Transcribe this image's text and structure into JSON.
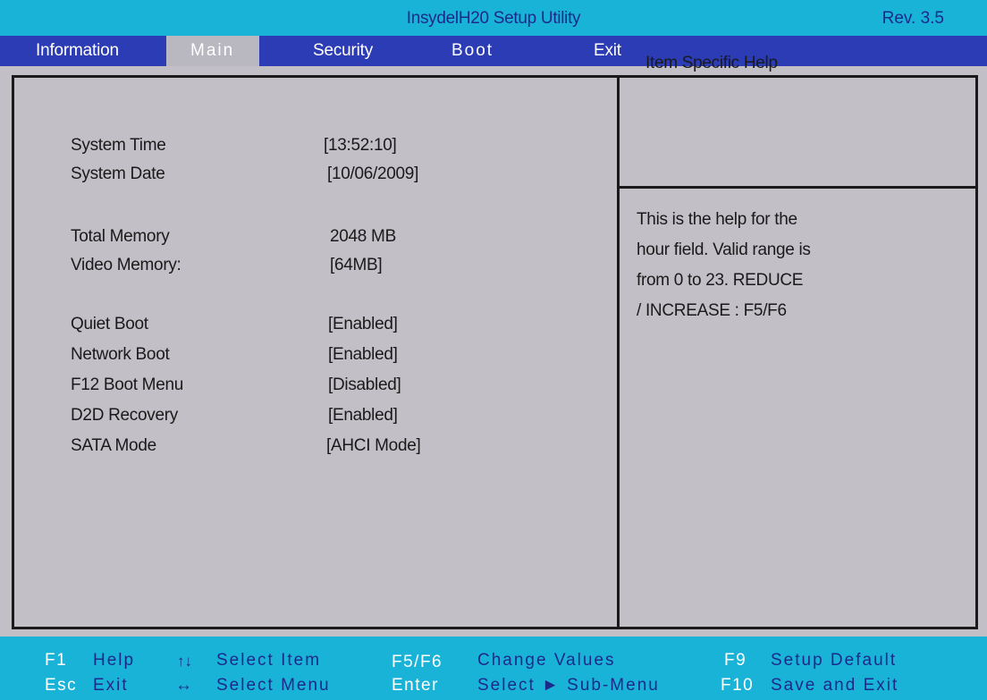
{
  "title_bar": {
    "title": "InsydelH20 Setup Utility",
    "revision": "Rev. 3.5"
  },
  "menu": {
    "items": [
      {
        "label": "Information"
      },
      {
        "label": "Main",
        "active": true
      },
      {
        "label": "Security"
      },
      {
        "label": "Boot"
      },
      {
        "label": "Exit"
      }
    ]
  },
  "fields": [
    {
      "label": "System Time",
      "value": "[13:52:10]"
    },
    {
      "label": "System Date",
      "value": "[10/06/2009]"
    },
    {
      "label": "Total Memory",
      "value": "2048 MB"
    },
    {
      "label": "Video Memory:",
      "value": "[64MB]"
    },
    {
      "label": "Quiet Boot",
      "value": "[Enabled]"
    },
    {
      "label": "Network Boot",
      "value": "[Enabled]"
    },
    {
      "label": "F12  Boot Menu",
      "value": "[Disabled]"
    },
    {
      "label": "D2D Recovery",
      "value": "[Enabled]"
    },
    {
      "label": "SATA Mode",
      "value": "[AHCI Mode]"
    }
  ],
  "help": {
    "title": "Item Specific Help",
    "lines": [
      "This is the help for the",
      "hour field. Valid range is",
      "from 0 to 23. REDUCE",
      "/ INCREASE  :  F5/F6"
    ]
  },
  "footer": {
    "row1": [
      {
        "key": "F1",
        "desc": "Help"
      },
      {
        "key_icon": "up-down-arrows-icon",
        "glyph": "↑↓",
        "desc": "Select  Item"
      },
      {
        "key": "F5/F6",
        "desc": "Change  Values"
      },
      {
        "key": "F9",
        "desc": "Setup  Default"
      }
    ],
    "row2": [
      {
        "key": "Esc",
        "desc": "Exit"
      },
      {
        "key_icon": "left-right-arrow-icon",
        "glyph": "↔",
        "desc": "Select  Menu"
      },
      {
        "key": "Enter",
        "desc": "Select  ► Sub-Menu"
      },
      {
        "key": "F10",
        "desc": "Save  and  Exit"
      }
    ]
  },
  "colors": {
    "title_bar": "#1ab3d8",
    "menu_bar": "#2b3cb4",
    "panel": "#c2bfc6",
    "footer": "#1ab3d8"
  }
}
